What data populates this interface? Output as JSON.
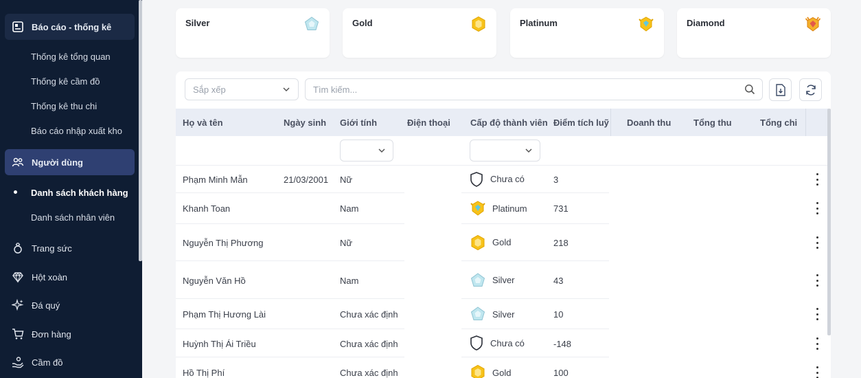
{
  "sidebar": {
    "group_reports": "Báo cáo - thống kê",
    "reports": [
      "Thống kê tổng quan",
      "Thống kê cầm đồ",
      "Thống kê thu chi",
      "Báo cáo nhập xuất kho"
    ],
    "group_users": "Người dùng",
    "users": [
      "Danh sách khách hàng",
      "Danh sách nhân viên"
    ],
    "items": [
      {
        "label": "Trang sức",
        "icon": "ring-icon"
      },
      {
        "label": "Hột xoàn",
        "icon": "diamond-icon"
      },
      {
        "label": "Đá quý",
        "icon": "sparkle-icon"
      },
      {
        "label": "Đơn hàng",
        "icon": "cart-icon"
      },
      {
        "label": "Cầm đồ",
        "icon": "pawn-hand-icon"
      }
    ]
  },
  "tiers": [
    {
      "name": "Silver",
      "color": "#a9d9e6"
    },
    {
      "name": "Gold",
      "color": "#f5c518"
    },
    {
      "name": "Platinum",
      "color": "#f5c518"
    },
    {
      "name": "Diamond",
      "color": "#f0a31b"
    }
  ],
  "toolbar": {
    "sort_placeholder": "Sắp xếp",
    "search_placeholder": "Tìm kiếm..."
  },
  "table": {
    "columns": [
      "Họ và tên",
      "Ngày sinh",
      "Giới tính",
      "Điện thoại",
      "Cấp độ thành viên",
      "Điểm tích luỹ",
      "Doanh thu",
      "Tổng thu",
      "Tổng chi"
    ],
    "rows": [
      {
        "name": "Phạm Minh Mẫn",
        "dob": "21/03/2001",
        "gender": "Nữ",
        "tier": "Chưa có",
        "tier_icon": "shield-outline-icon",
        "points": "3"
      },
      {
        "name": "Khanh Toan",
        "dob": "",
        "gender": "Nam",
        "tier": "Platinum",
        "tier_icon": "platinum-badge-icon",
        "points": "731"
      },
      {
        "name": "Nguyễn Thị Phương",
        "dob": "",
        "gender": "Nữ",
        "tier": "Gold",
        "tier_icon": "gold-badge-icon",
        "points": "218"
      },
      {
        "name": "Nguyễn Văn Hồ",
        "dob": "",
        "gender": "Nam",
        "tier": "Silver",
        "tier_icon": "silver-badge-icon",
        "points": "43"
      },
      {
        "name": "Phạm Thị Hương Lài",
        "dob": "",
        "gender": "Chưa xác định",
        "tier": "Silver",
        "tier_icon": "silver-badge-icon",
        "points": "10"
      },
      {
        "name": "Huỳnh Thị Ái Triều",
        "dob": "",
        "gender": "Chưa xác định",
        "tier": "Chưa có",
        "tier_icon": "shield-outline-icon",
        "points": "-148"
      },
      {
        "name": "Hồ Thị Phí",
        "dob": "",
        "gender": "Chưa xác định",
        "tier": "Gold",
        "tier_icon": "gold-badge-icon",
        "points": "100"
      }
    ]
  }
}
